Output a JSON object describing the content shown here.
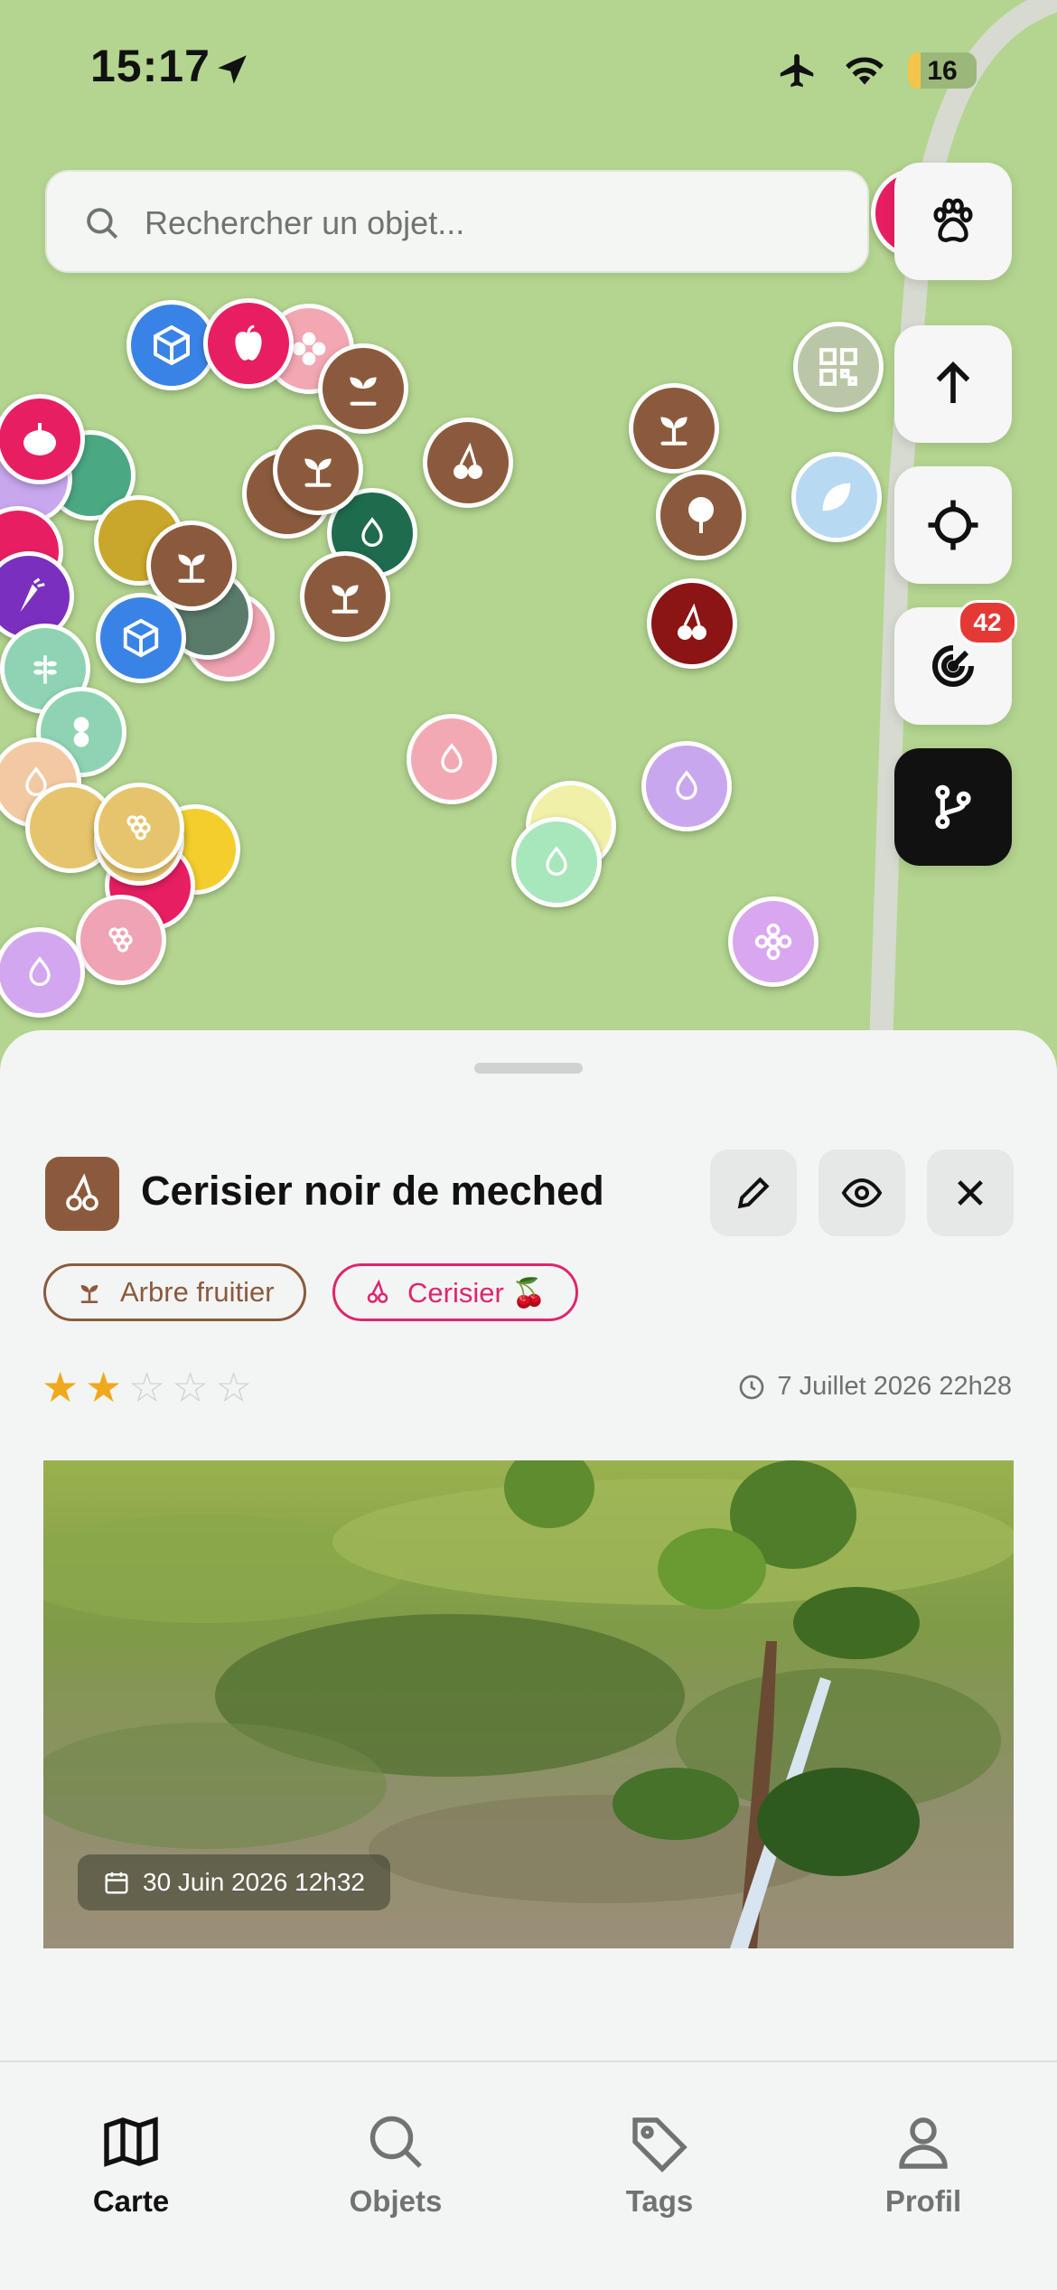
{
  "status_bar": {
    "time": "15:17",
    "battery": "16"
  },
  "search": {
    "placeholder": "Rechercher un objet..."
  },
  "map_controls": {
    "notifications_count": "42"
  },
  "detail": {
    "title": "Cerisier noir de meched",
    "tags": [
      {
        "label": "Arbre fruitier",
        "color": "#8b5a3c"
      },
      {
        "label": "Cerisier 🍒",
        "color": "#e0256d"
      }
    ],
    "rating": 2,
    "rating_max": 5,
    "created": "7 Juillet 2026 22h28",
    "photo_date": "30 Juin 2026 12h32"
  },
  "tabs": [
    {
      "label": "Carte",
      "icon": "map-icon",
      "active": true
    },
    {
      "label": "Objets",
      "icon": "search-icon",
      "active": false
    },
    {
      "label": "Tags",
      "icon": "tag-icon",
      "active": false
    },
    {
      "label": "Profil",
      "icon": "person-icon",
      "active": false
    }
  ],
  "pins": [
    {
      "color": "#3a83e6",
      "icon": "box-icon"
    },
    {
      "color": "#e81e63",
      "icon": "apple-icon"
    },
    {
      "color": "#f2a7b3",
      "icon": "flower-icon"
    },
    {
      "color": "#8b5a3c",
      "icon": "sprout-icon"
    },
    {
      "color": "#8b5a3c",
      "icon": "cherry-icon"
    },
    {
      "color": "#8b5a3c",
      "icon": "sprout-icon"
    },
    {
      "color": "#8b5a3c",
      "icon": "tree-icon"
    },
    {
      "color": "#8b1414",
      "icon": "cherry-icon"
    },
    {
      "color": "#b9c7a6",
      "icon": "qr-icon"
    },
    {
      "color": "#b8d9f2",
      "icon": "leaf-icon"
    },
    {
      "color": "#f3a9b4",
      "icon": "drop-icon"
    },
    {
      "color": "#c8a7ef",
      "icon": "drop-icon"
    },
    {
      "color": "#a8e6bb",
      "icon": "drop-icon"
    },
    {
      "color": "#d9a7ef",
      "icon": "flower-icon"
    },
    {
      "color": "#e81e63",
      "icon": "pumpkin-icon"
    },
    {
      "color": "#7b2fbe",
      "icon": "carrot-icon"
    },
    {
      "color": "#3a83e6",
      "icon": "box-icon"
    },
    {
      "color": "#8ed3b2",
      "icon": "peanut-icon"
    },
    {
      "color": "#e6c46b",
      "icon": "grapes-icon"
    },
    {
      "color": "#f0a3b2",
      "icon": "grapes-icon"
    },
    {
      "color": "#d2a7ef",
      "icon": "drop-icon"
    }
  ]
}
